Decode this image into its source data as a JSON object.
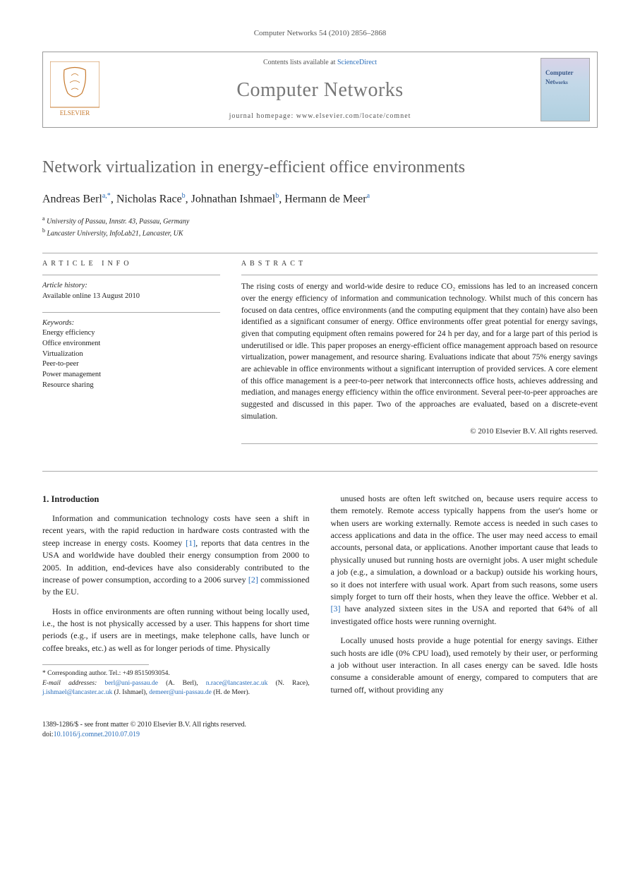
{
  "citation": "Computer Networks 54 (2010) 2856–2868",
  "header": {
    "contents_line_prefix": "Contents lists available at ",
    "contents_line_link": "ScienceDirect",
    "journal_name": "Computer Networks",
    "homepage_label": "journal homepage: www.elsevier.com/locate/comnet",
    "cover_label": "Computer Networks"
  },
  "title": "Network virtualization in energy-efficient office environments",
  "authors": [
    {
      "name": "Andreas Berl",
      "marks": "a,*"
    },
    {
      "name": "Nicholas Race",
      "marks": "b"
    },
    {
      "name": "Johnathan Ishmael",
      "marks": "b"
    },
    {
      "name": "Hermann de Meer",
      "marks": "a"
    }
  ],
  "affiliations": [
    {
      "mark": "a",
      "text": "University of Passau, Innstr. 43, Passau, Germany"
    },
    {
      "mark": "b",
      "text": "Lancaster University, InfoLab21, Lancaster, UK"
    }
  ],
  "article_info": {
    "section_label": "ARTICLE INFO",
    "history_label": "Article history:",
    "history_text": "Available online 13 August 2010",
    "keywords_label": "Keywords:",
    "keywords": [
      "Energy efficiency",
      "Office environment",
      "Virtualization",
      "Peer-to-peer",
      "Power management",
      "Resource sharing"
    ]
  },
  "abstract": {
    "label": "ABSTRACT",
    "text": "The rising costs of energy and world-wide desire to reduce CO₂ emissions has led to an increased concern over the energy efficiency of information and communication technology. Whilst much of this concern has focused on data centres, office environments (and the computing equipment that they contain) have also been identified as a significant consumer of energy. Office environments offer great potential for energy savings, given that computing equipment often remains powered for 24 h per day, and for a large part of this period is underutilised or idle. This paper proposes an energy-efficient office management approach based on resource virtualization, power management, and resource sharing. Evaluations indicate that about 75% energy savings are achievable in office environments without a significant interruption of provided services. A core element of this office management is a peer-to-peer network that interconnects office hosts, achieves addressing and mediation, and manages energy efficiency within the office environment. Several peer-to-peer approaches are suggested and discussed in this paper. Two of the approaches are evaluated, based on a discrete-event simulation.",
    "copyright": "© 2010 Elsevier B.V. All rights reserved."
  },
  "body": {
    "section_heading": "1. Introduction",
    "col1_p1": "Information and communication technology costs have seen a shift in recent years, with the rapid reduction in hardware costs contrasted with the steep increase in energy costs. Koomey [1], reports that data centres in the USA and worldwide have doubled their energy consumption from 2000 to 2005. In addition, end-devices have also considerably contributed to the increase of power consumption, according to a 2006 survey [2] commissioned by the EU.",
    "col1_p2": "Hosts in office environments are often running without being locally used, i.e., the host is not physically accessed by a user. This happens for short time periods (e.g., if users are in meetings, make telephone calls, have lunch or coffee breaks, etc.) as well as for longer periods of time. Physically",
    "col2_p1": "unused hosts are often left switched on, because users require access to them remotely. Remote access typically happens from the user's home or when users are working externally. Remote access is needed in such cases to access applications and data in the office. The user may need access to email accounts, personal data, or applications. Another important cause that leads to physically unused but running hosts are overnight jobs. A user might schedule a job (e.g., a simulation, a download or a backup) outside his working hours, so it does not interfere with usual work. Apart from such reasons, some users simply forget to turn off their hosts, when they leave the office. Webber et al. [3] have analyzed sixteen sites in the USA and reported that 64% of all investigated office hosts were running overnight.",
    "col2_p2": "Locally unused hosts provide a huge potential for energy savings. Either such hosts are idle (0% CPU load), used remotely by their user, or performing a job without user interaction. In all cases energy can be saved. Idle hosts consume a considerable amount of energy, compared to computers that are turned off, without providing any"
  },
  "footnote": {
    "corresponding": "* Corresponding author. Tel.: +49 8515093054.",
    "email_label": "E-mail addresses:",
    "emails": [
      {
        "addr": "berl@uni-passau.de",
        "who": "(A. Berl)"
      },
      {
        "addr": "n.race@lancaster.ac.uk",
        "who": "(N. Race)"
      },
      {
        "addr": "j.ishmael@lancaster.ac.uk",
        "who": "(J. Ishmael)"
      },
      {
        "addr": "demeer@uni-passau.de",
        "who": "(H. de Meer)"
      }
    ]
  },
  "footer": {
    "line1": "1389-1286/$ - see front matter © 2010 Elsevier B.V. All rights reserved.",
    "doi_prefix": "doi:",
    "doi": "10.1016/j.comnet.2010.07.019"
  },
  "refs": {
    "r1": "[1]",
    "r2": "[2]",
    "r3": "[3]"
  }
}
